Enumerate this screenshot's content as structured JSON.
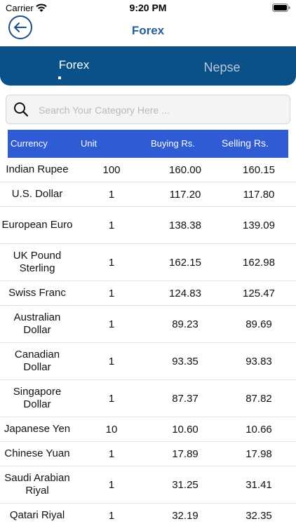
{
  "status_bar": {
    "carrier": "Carrier",
    "time": "9:20 PM"
  },
  "nav": {
    "title": "Forex"
  },
  "tabs": [
    {
      "label": "Forex",
      "active": true
    },
    {
      "label": "Nepse",
      "active": false
    }
  ],
  "search": {
    "placeholder": "Search Your Category Here ...",
    "value": ""
  },
  "table": {
    "headers": {
      "currency": "Currency",
      "unit": "Unit",
      "buying": "Buying Rs.",
      "selling": "Selling Rs."
    },
    "rows": [
      {
        "currency": "Indian Rupee",
        "unit": "100",
        "buying": "160.00",
        "selling": "160.15"
      },
      {
        "currency": "U.S. Dollar",
        "unit": "1",
        "buying": "117.20",
        "selling": "117.80"
      },
      {
        "currency": "European Euro",
        "unit": "1",
        "buying": "138.38",
        "selling": "139.09"
      },
      {
        "currency": "UK Pound Sterling",
        "unit": "1",
        "buying": "162.15",
        "selling": "162.98"
      },
      {
        "currency": "Swiss Franc",
        "unit": "1",
        "buying": "124.83",
        "selling": "125.47"
      },
      {
        "currency": "Australian Dollar",
        "unit": "1",
        "buying": "89.23",
        "selling": "89.69"
      },
      {
        "currency": "Canadian Dollar",
        "unit": "1",
        "buying": "93.35",
        "selling": "93.83"
      },
      {
        "currency": "Singapore Dollar",
        "unit": "1",
        "buying": "87.37",
        "selling": "87.82"
      },
      {
        "currency": "Japanese Yen",
        "unit": "10",
        "buying": "10.60",
        "selling": "10.66"
      },
      {
        "currency": "Chinese Yuan",
        "unit": "1",
        "buying": "17.89",
        "selling": "17.98"
      },
      {
        "currency": "Saudi Arabian Riyal",
        "unit": "1",
        "buying": "31.25",
        "selling": "31.41"
      },
      {
        "currency": "Qatari Riyal",
        "unit": "1",
        "buying": "32.19",
        "selling": "32.35"
      }
    ]
  },
  "colors": {
    "nav_blue": "#0a5089",
    "header_blue": "#2f5bd4",
    "title_blue": "#1f5f99"
  },
  "icons": {
    "back": "back-arrow-icon",
    "search": "search-icon",
    "wifi": "wifi-icon",
    "battery": "battery-icon"
  }
}
